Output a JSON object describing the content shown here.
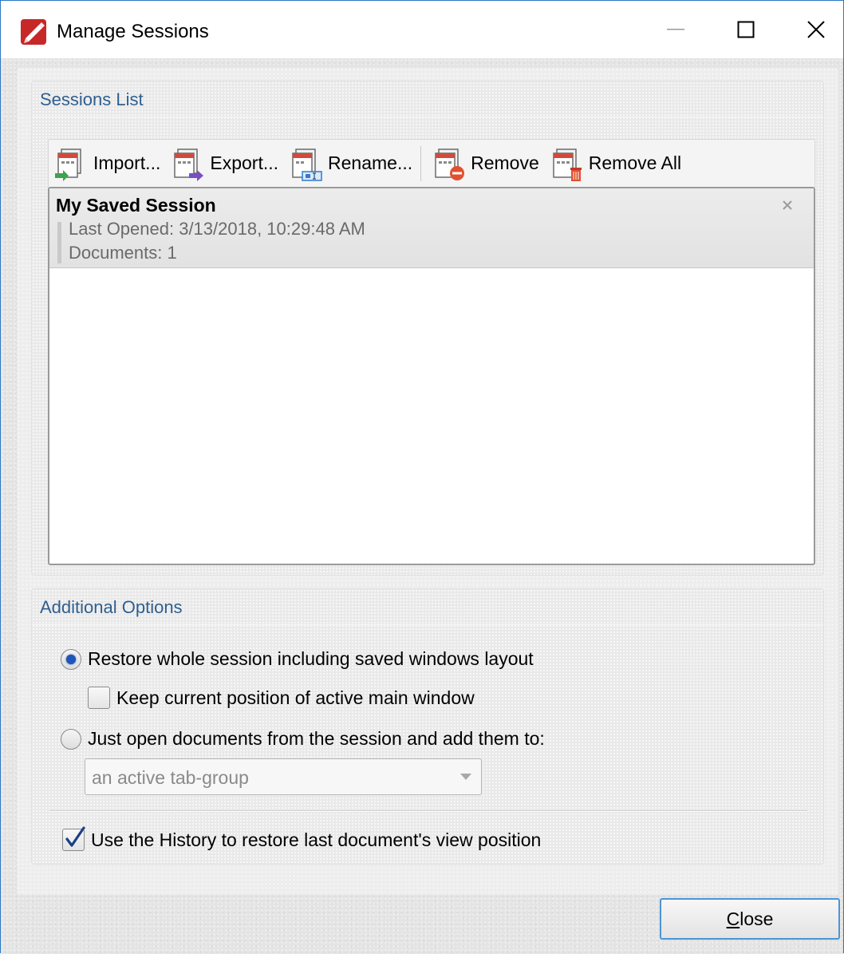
{
  "window": {
    "title": "Manage Sessions",
    "icon": "pdf-xchange-app-icon",
    "controls": [
      "minimize",
      "maximize",
      "close"
    ]
  },
  "sessions_group": {
    "title": "Sessions List",
    "toolbar": [
      {
        "label": "Import...",
        "icon": "session-import-icon"
      },
      {
        "label": "Export...",
        "icon": "session-export-icon"
      },
      {
        "label": "Rename...",
        "icon": "session-rename-icon"
      },
      {
        "label": "Remove",
        "icon": "session-remove-icon"
      },
      {
        "label": "Remove All",
        "icon": "session-remove-all-icon"
      }
    ],
    "sessions": [
      {
        "name": "My Saved Session",
        "last_opened": "Last Opened: 3/13/2018, 10:29:48 AM",
        "documents": "Documents: 1"
      }
    ]
  },
  "options_group": {
    "title": "Additional Options",
    "restore_whole": {
      "label": "Restore whole session including saved windows layout",
      "checked": true
    },
    "keep_position": {
      "label": "Keep current position of active main window",
      "checked": false
    },
    "just_open": {
      "label": "Just open documents from the session and add them to:",
      "checked": false
    },
    "target_select": {
      "value": "an active tab-group",
      "enabled": false
    },
    "use_history": {
      "label": "Use the History to restore last document's view position",
      "checked": true
    }
  },
  "footer": {
    "close_label_accel": "C",
    "close_label_rest": "lose"
  },
  "colors": {
    "group_title": "#2f5f8f",
    "radio_selected": "#1d56b8",
    "focus_border": "#4b95d6"
  }
}
